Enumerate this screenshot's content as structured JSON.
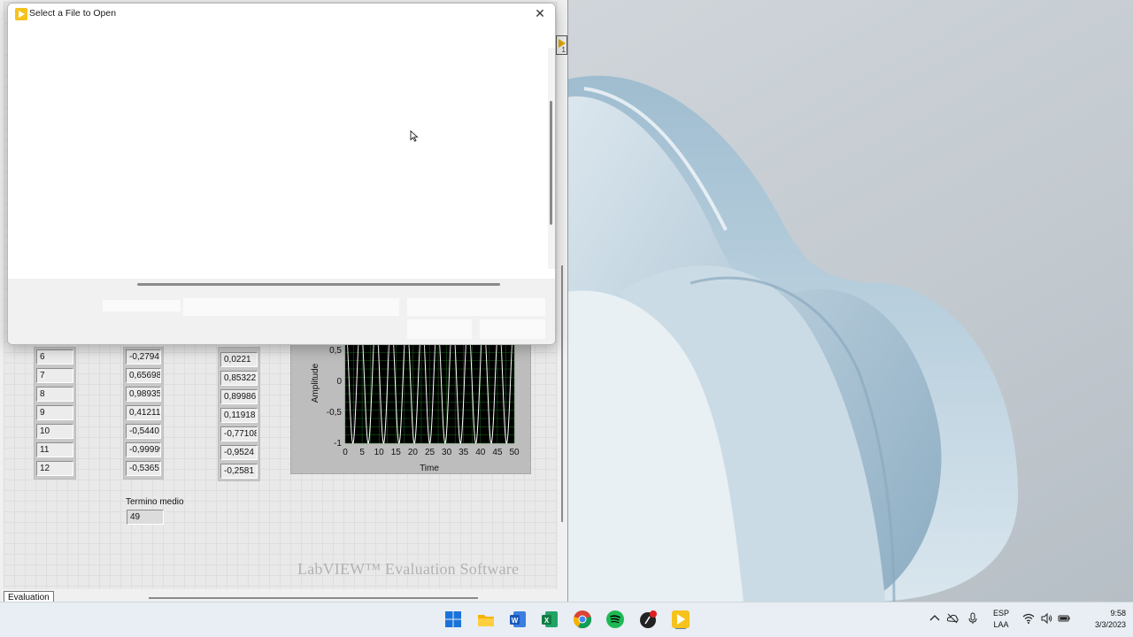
{
  "dialog": {
    "title": "Select a File to Open",
    "close_symbol": "✕",
    "app_icon": "labview-icon"
  },
  "front_panel": {
    "tab_label": "Evaluation",
    "watermark": "LabVIEW™ Evaluation Software",
    "index_array": [
      "6",
      "7",
      "8",
      "9",
      "10",
      "11",
      "12"
    ],
    "array_2": [
      "-0,2794",
      "0,65698",
      "0,98935",
      "0,41211",
      "-0,5440",
      "-0,99999",
      "-0,5365"
    ],
    "array_3": [
      "0,0221",
      "0,85322",
      "0,89986",
      "0,11918",
      "-0,77108",
      "-0,9524",
      "-0,2581"
    ],
    "mean_label": "Termino medio",
    "mean_value": "49"
  },
  "chart_data": {
    "type": "line",
    "title": "",
    "xlabel": "Time",
    "ylabel": "Amplitude",
    "xlim": [
      0,
      50
    ],
    "ylim": [
      -1,
      0.6
    ],
    "x_ticks": [
      "0",
      "5",
      "10",
      "15",
      "20",
      "25",
      "30",
      "35",
      "40",
      "45",
      "50"
    ],
    "y_ticks": [
      "0,5",
      "0",
      "-0,5",
      "-1"
    ],
    "series": [
      {
        "function": "sine",
        "amplitude": 1,
        "cycles": 11,
        "color": "#ffffff"
      }
    ],
    "background": "#000000",
    "grid_color": "#1f6b1f",
    "grid": true
  },
  "taskbar": {
    "apps": [
      "windows-start-icon",
      "file-explorer-icon",
      "word-icon",
      "excel-icon",
      "chrome-icon",
      "spotify-icon",
      "music-app-icon",
      "labview-icon"
    ],
    "lang_line1": "ESP",
    "lang_line2": "LAA",
    "time": "9:58",
    "date": "3/3/2023"
  }
}
